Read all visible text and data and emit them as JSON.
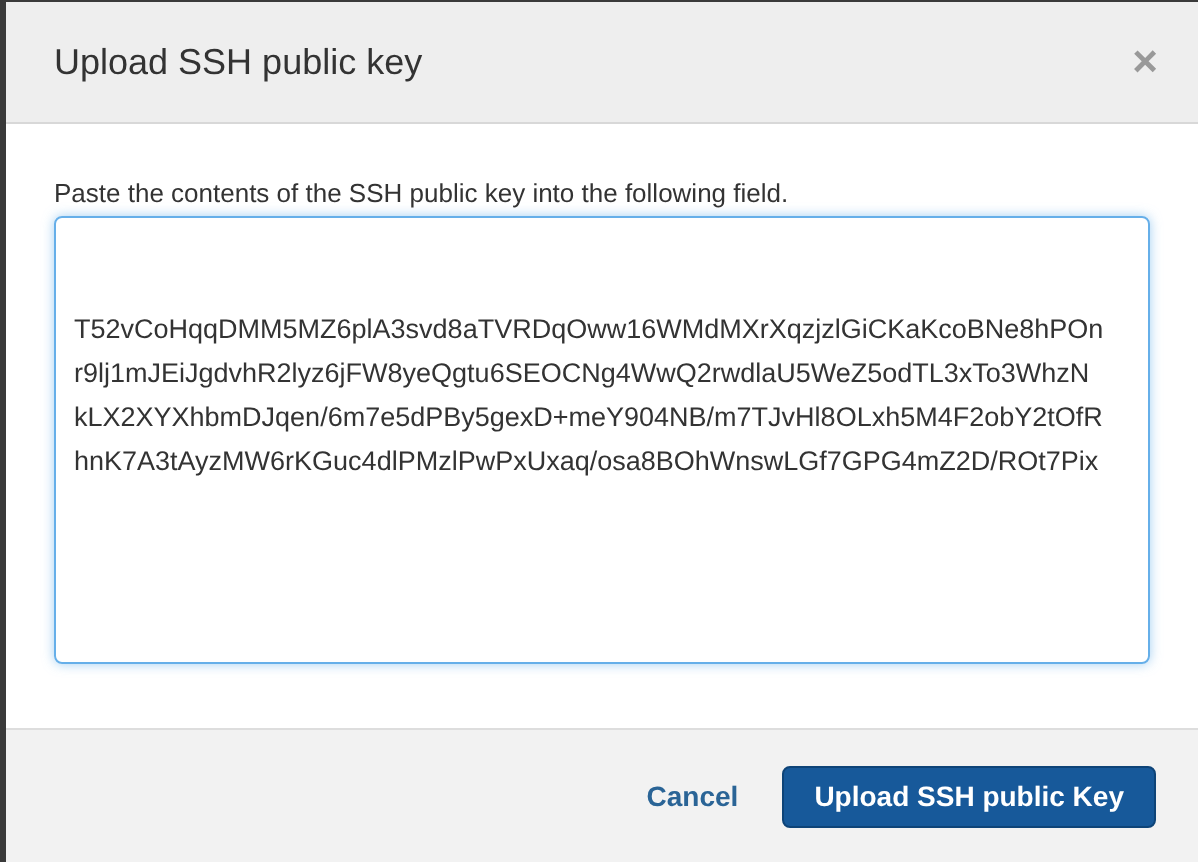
{
  "dialog": {
    "title": "Upload SSH public key",
    "close": "×"
  },
  "instructions": "Paste the contents of the SSH public key into the following field.",
  "key_field": {
    "lines": [
      "T52vCoHqqDMM5MZ6plA3svd8aTVRDqOww16WMdMXrXqzjzlGiCKaKcoBNe8hPOn",
      "r9lj1mJEiJgdvhR2lyz6jFW8yeQgtu6SEOCNg4WwQ2rwdlaU5WeZ5odTL3xTo3WhzN",
      "kLX2XYXhbmDJqen/6m7e5dPBy5gexD+meY904NB/m7TJvHl8OLxh5M4F2obY2tOfR",
      "hnK7A3tAyzMW6rKGuc4dlPMzlPwPxUxaq/osa8BOhWnswLGf7GPG4mZ2D/ROt7Pix"
    ]
  },
  "buttons": [
    {
      "kind": "link",
      "label": "Cancel"
    },
    {
      "kind": "primary",
      "label": "Upload SSH public Key"
    }
  ]
}
